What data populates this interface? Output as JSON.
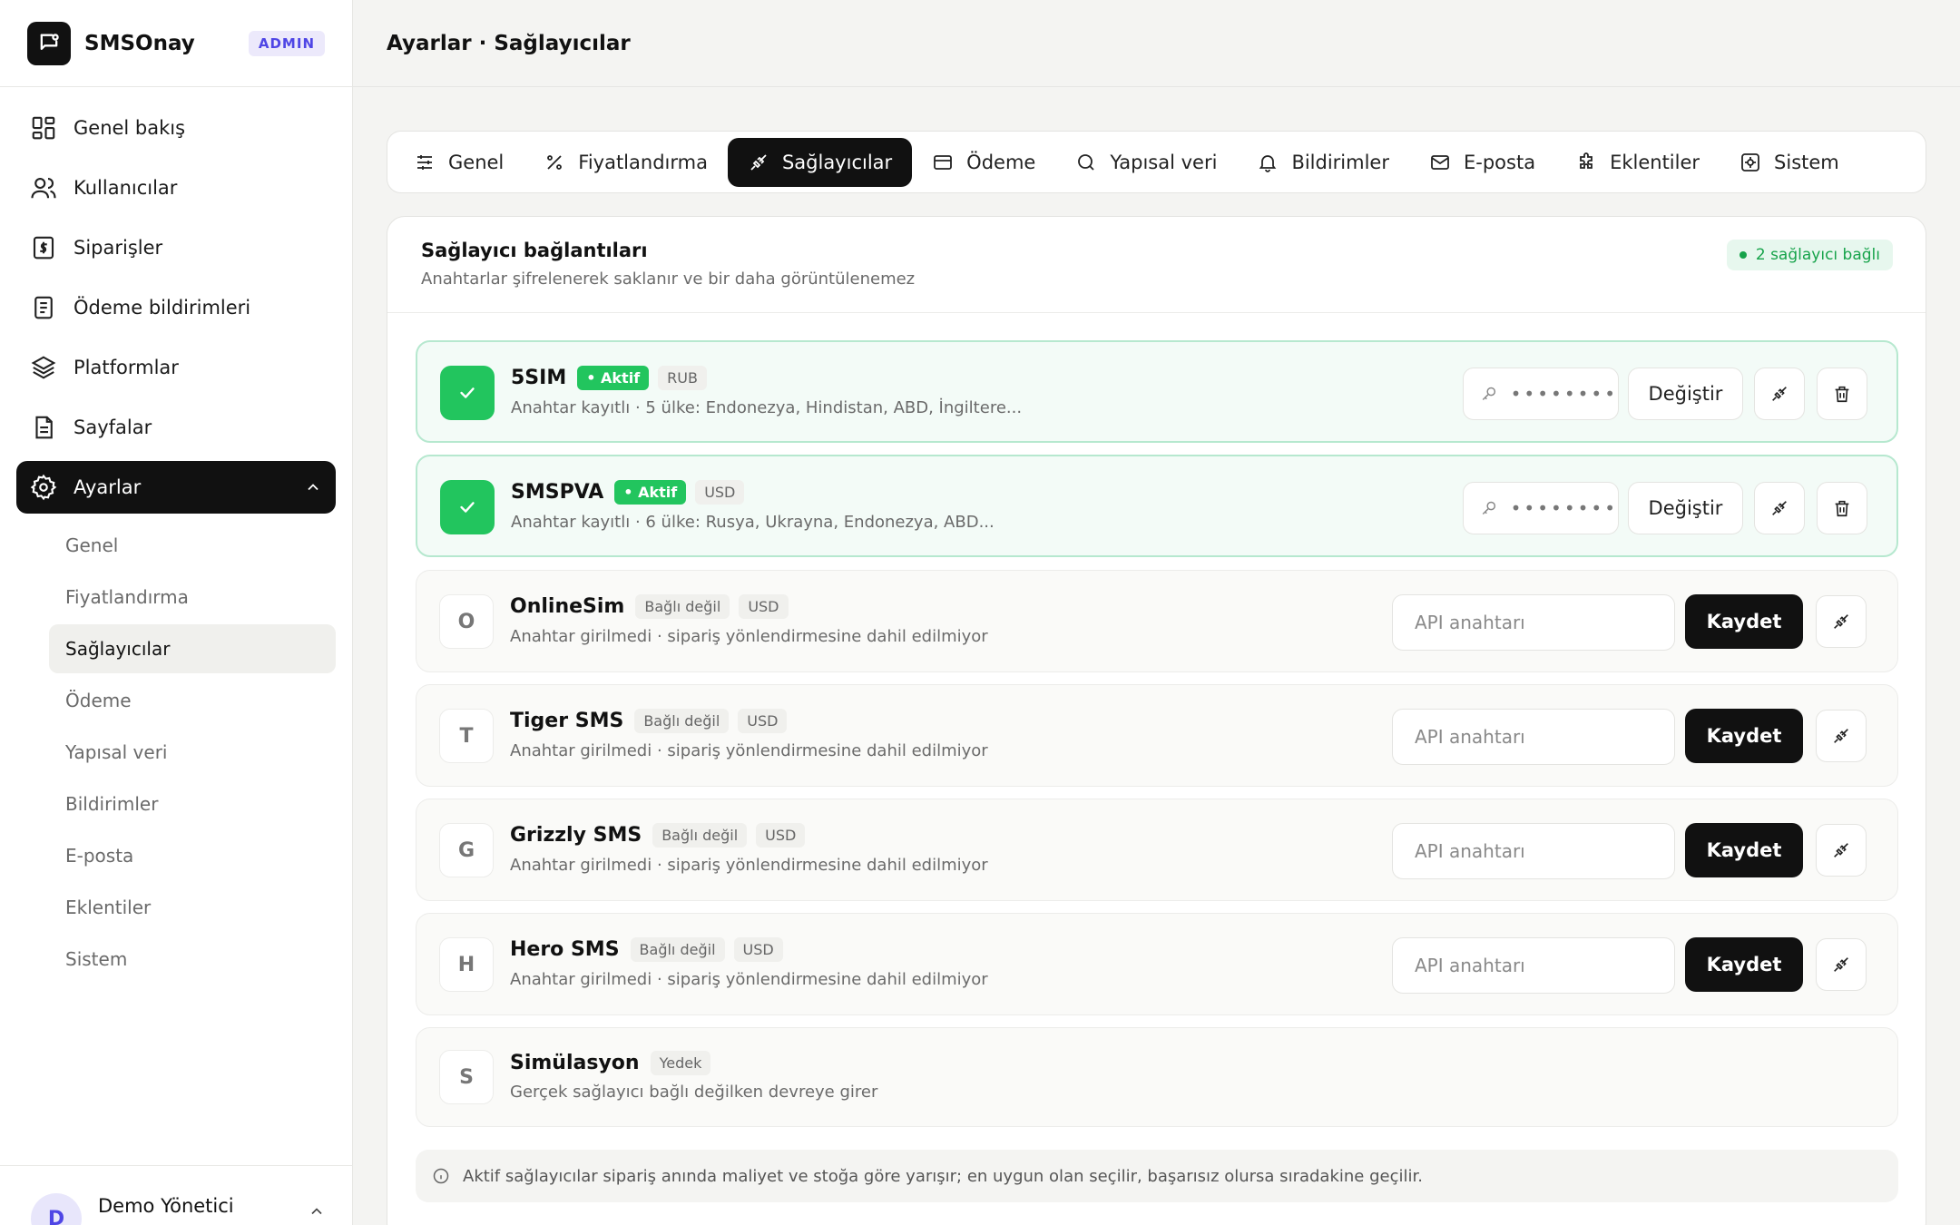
{
  "app": {
    "name": "SMSOnay",
    "badge": "ADMIN"
  },
  "header": {
    "title": "Ayarlar · Sağlayıcılar"
  },
  "sidebar": {
    "items": [
      {
        "label": "Genel bakış",
        "icon": "dashboard-icon"
      },
      {
        "label": "Kullanıcılar",
        "icon": "users-icon"
      },
      {
        "label": "Siparişler",
        "icon": "receipt-icon"
      },
      {
        "label": "Ödeme bildirimleri",
        "icon": "document-list-icon"
      },
      {
        "label": "Platformlar",
        "icon": "layers-icon"
      },
      {
        "label": "Sayfalar",
        "icon": "file-icon"
      },
      {
        "label": "Ayarlar",
        "icon": "gear-icon",
        "active": true
      }
    ],
    "sub_items": [
      {
        "label": "Genel"
      },
      {
        "label": "Fiyatlandırma"
      },
      {
        "label": "Sağlayıcılar",
        "active": true
      },
      {
        "label": "Ödeme"
      },
      {
        "label": "Yapısal veri"
      },
      {
        "label": "Bildirimler"
      },
      {
        "label": "E-posta"
      },
      {
        "label": "Eklentiler"
      },
      {
        "label": "Sistem"
      }
    ]
  },
  "user": {
    "initial": "D",
    "name": "Demo Yönetici"
  },
  "tabs": [
    {
      "label": "Genel",
      "icon": "sliders-icon"
    },
    {
      "label": "Fiyatlandırma",
      "icon": "percent-icon"
    },
    {
      "label": "Sağlayıcılar",
      "icon": "plug-icon",
      "active": true
    },
    {
      "label": "Ödeme",
      "icon": "credit-card-icon"
    },
    {
      "label": "Yapısal veri",
      "icon": "search-icon"
    },
    {
      "label": "Bildirimler",
      "icon": "bell-icon"
    },
    {
      "label": "E-posta",
      "icon": "mail-icon"
    },
    {
      "label": "Eklentiler",
      "icon": "puzzle-icon"
    },
    {
      "label": "Sistem",
      "icon": "system-icon"
    }
  ],
  "card": {
    "title": "Sağlayıcı bağlantıları",
    "subtitle": "Anahtarlar şifrelenerek saklanır ve bir daha görüntülenemez",
    "connected_badge": "2 sağlayıcı bağlı"
  },
  "providers": [
    {
      "initial": "",
      "name": "5SIM",
      "status": "• Aktif",
      "currency": "RUB",
      "desc": "Anahtar kayıtlı · 5 ülke: Endonezya, Hindistan, ABD, İngiltere...",
      "masked_key": "••••••••",
      "change_label": "Değiştir"
    },
    {
      "initial": "",
      "name": "SMSPVA",
      "status": "• Aktif",
      "currency": "USD",
      "desc": "Anahtar kayıtlı · 6 ülke: Rusya, Ukrayna, Endonezya, ABD...",
      "masked_key": "••••••••",
      "change_label": "Değiştir"
    },
    {
      "initial": "O",
      "name": "OnlineSim",
      "status": "Bağlı değil",
      "currency": "USD",
      "desc": "Anahtar girilmedi · sipariş yönlendirmesine dahil edilmiyor",
      "placeholder": "API anahtarı",
      "save_label": "Kaydet"
    },
    {
      "initial": "T",
      "name": "Tiger SMS",
      "status": "Bağlı değil",
      "currency": "USD",
      "desc": "Anahtar girilmedi · sipariş yönlendirmesine dahil edilmiyor",
      "placeholder": "API anahtarı",
      "save_label": "Kaydet"
    },
    {
      "initial": "G",
      "name": "Grizzly SMS",
      "status": "Bağlı değil",
      "currency": "USD",
      "desc": "Anahtar girilmedi · sipariş yönlendirmesine dahil edilmiyor",
      "placeholder": "API anahtarı",
      "save_label": "Kaydet"
    },
    {
      "initial": "H",
      "name": "Hero SMS",
      "status": "Bağlı değil",
      "currency": "USD",
      "desc": "Anahtar girilmedi · sipariş yönlendirmesine dahil edilmiyor",
      "placeholder": "API anahtarı",
      "save_label": "Kaydet"
    },
    {
      "initial": "S",
      "name": "Simülasyon",
      "status": "Yedek",
      "desc": "Gerçek sağlayıcı bağlı değilken devreye girer"
    }
  ],
  "footer_note": "Aktif sağlayıcılar sipariş anında maliyet ve stoğa göre yarışır; en uygun olan seçilir, başarısız olursa sıradakine geçilir.",
  "colors": {
    "accent": "#111111",
    "active_green": "#22c55e",
    "admin_badge": "#4f46e5"
  }
}
